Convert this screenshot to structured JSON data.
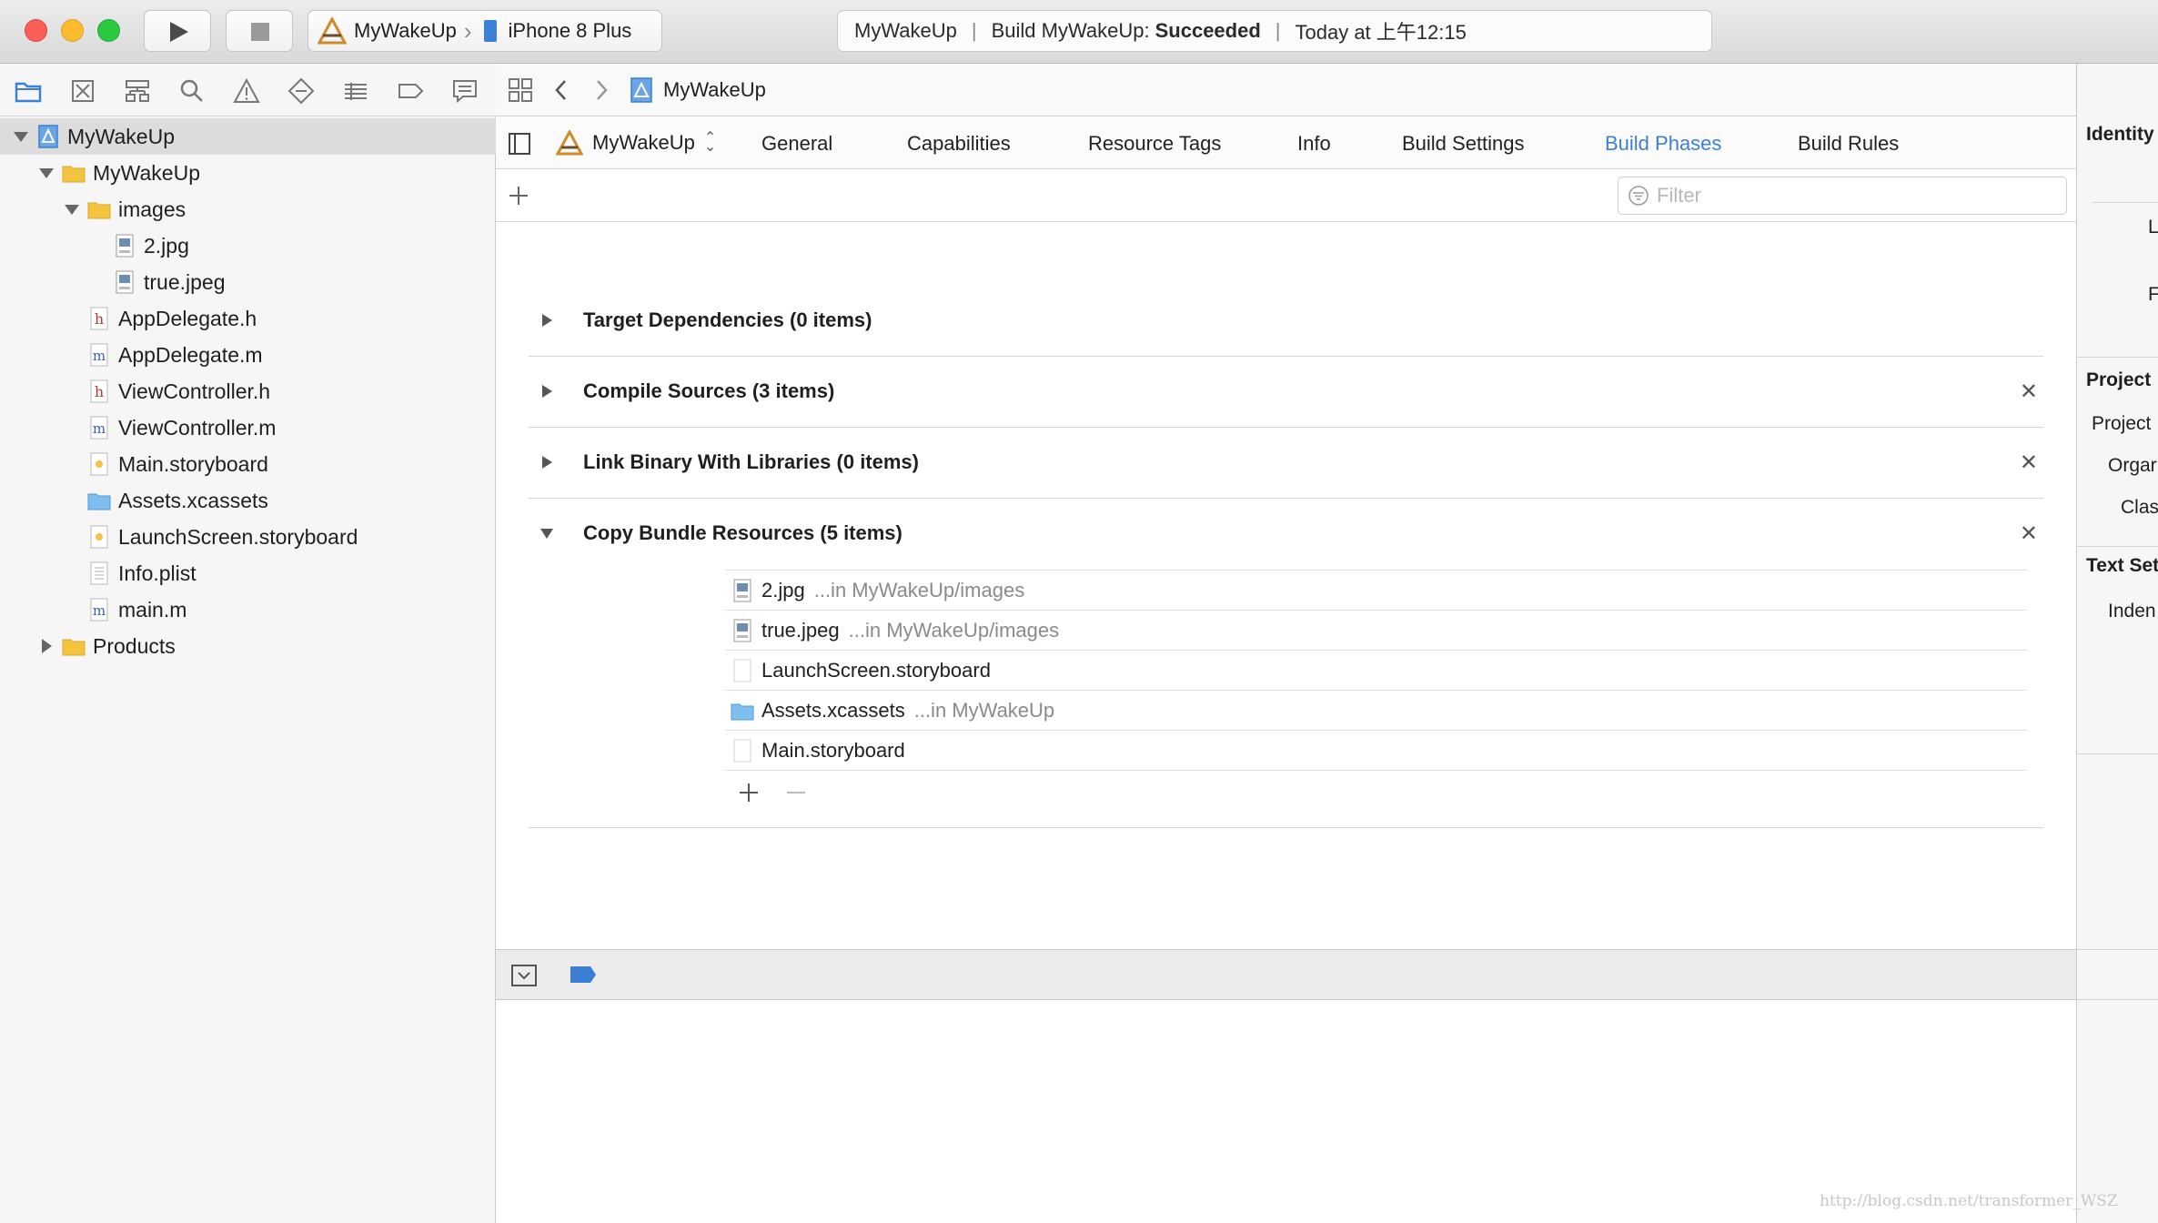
{
  "toolbar": {
    "scheme_target": "MyWakeUp",
    "scheme_device": "iPhone 8 Plus",
    "activity_project": "MyWakeUp",
    "activity_build_label": "Build MyWakeUp:",
    "activity_build_status": "Succeeded",
    "activity_time": "Today at 上午12:15"
  },
  "navigator": {
    "tabs": [
      "folder-icon",
      "source-control-icon",
      "hierarchy-icon",
      "search-icon",
      "warning-icon",
      "test-icon",
      "debug-icon",
      "breakpoint-icon",
      "report-icon"
    ],
    "tree": [
      {
        "label": "MyWakeUp",
        "level": 0,
        "icon": "project",
        "disclosure": "open",
        "selected": true
      },
      {
        "label": "MyWakeUp",
        "level": 1,
        "icon": "folder",
        "disclosure": "open"
      },
      {
        "label": "images",
        "level": 2,
        "icon": "folder",
        "disclosure": "open"
      },
      {
        "label": "2.jpg",
        "level": 3,
        "icon": "jpeg"
      },
      {
        "label": "true.jpeg",
        "level": 3,
        "icon": "jpeg"
      },
      {
        "label": "AppDelegate.h",
        "level": 2,
        "icon": "h"
      },
      {
        "label": "AppDelegate.m",
        "level": 2,
        "icon": "m"
      },
      {
        "label": "ViewController.h",
        "level": 2,
        "icon": "h"
      },
      {
        "label": "ViewController.m",
        "level": 2,
        "icon": "m"
      },
      {
        "label": "Main.storyboard",
        "level": 2,
        "icon": "storyboard"
      },
      {
        "label": "Assets.xcassets",
        "level": 2,
        "icon": "assets"
      },
      {
        "label": "LaunchScreen.storyboard",
        "level": 2,
        "icon": "storyboard"
      },
      {
        "label": "Info.plist",
        "level": 2,
        "icon": "plist"
      },
      {
        "label": "main.m",
        "level": 2,
        "icon": "m"
      },
      {
        "label": "Products",
        "level": 1,
        "icon": "folder",
        "disclosure": "closed"
      }
    ]
  },
  "editor": {
    "jumpbar_title": "MyWakeUp",
    "target": "MyWakeUp",
    "tabs": [
      "General",
      "Capabilities",
      "Resource Tags",
      "Info",
      "Build Settings",
      "Build Phases",
      "Build Rules"
    ],
    "active_tab": "Build Phases",
    "filter_placeholder": "Filter",
    "phases": [
      {
        "title": "Target Dependencies (0 items)",
        "expanded": false,
        "removable": false
      },
      {
        "title": "Compile Sources (3 items)",
        "expanded": false,
        "removable": true
      },
      {
        "title": "Link Binary With Libraries (0 items)",
        "expanded": false,
        "removable": true
      },
      {
        "title": "Copy Bundle Resources (5 items)",
        "expanded": true,
        "removable": true
      }
    ],
    "resources": [
      {
        "name": "2.jpg",
        "location": "...in MyWakeUp/images",
        "icon": "jpeg"
      },
      {
        "name": "true.jpeg",
        "location": "...in MyWakeUp/images",
        "icon": "jpeg"
      },
      {
        "name": "LaunchScreen.storyboard",
        "location": "",
        "icon": "blank"
      },
      {
        "name": "Assets.xcassets",
        "location": "...in MyWakeUp",
        "icon": "assets"
      },
      {
        "name": "Main.storyboard",
        "location": "",
        "icon": "blank"
      }
    ]
  },
  "inspector": {
    "identity_header": "Identity",
    "identity_labels": [
      "L",
      "F"
    ],
    "project_header": "Project",
    "project_labels": [
      "Project",
      "Orgar",
      "Clas"
    ],
    "text_header": "Text Set",
    "text_labels": [
      "Inden"
    ]
  },
  "watermark": "http://blog.csdn.net/transformer_WSZ",
  "colors": {
    "accent": "#3d7fd5",
    "folder": "#f3c53f",
    "selection": "#dcdcdc",
    "toolbar": "#e3e3e3"
  }
}
